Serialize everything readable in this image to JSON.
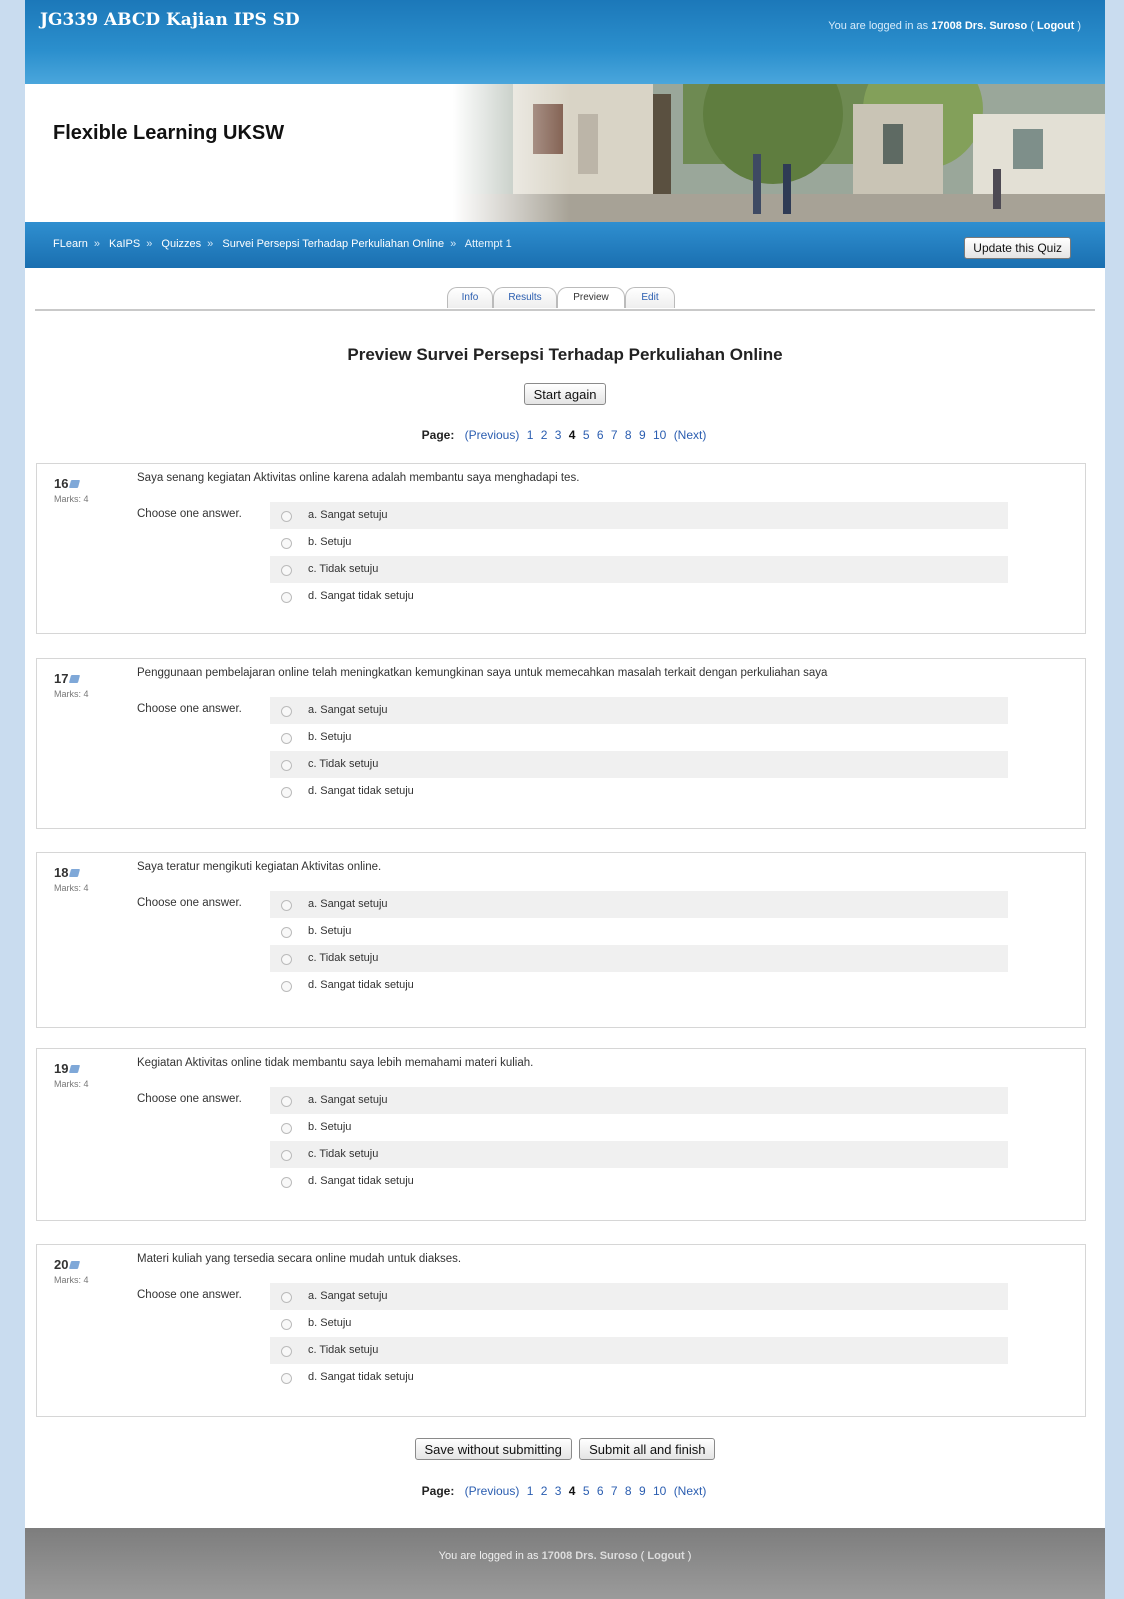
{
  "header": {
    "course_title": "JG339 ABCD Kajian IPS SD",
    "login_prefix": "You are logged in as",
    "user": "17008 Drs. Suroso",
    "logout": "Logout"
  },
  "banner": {
    "site_name": "Flexible Learning UKSW"
  },
  "breadcrumb": [
    "FLearn",
    "KaIPS",
    "Quizzes",
    "Survei Persepsi Terhadap Perkuliahan Online",
    "Attempt 1"
  ],
  "update_button": "Update this Quiz",
  "tabs": [
    "Info",
    "Results",
    "Preview",
    "Edit"
  ],
  "quiz_title": "Preview Survei Persepsi Terhadap Perkuliahan Online",
  "start_again": "Start again",
  "paging": {
    "label": "Page:",
    "previous": "(Previous)",
    "pages": [
      "1",
      "2",
      "3",
      "4",
      "5",
      "6",
      "7",
      "8",
      "9",
      "10"
    ],
    "current": "4",
    "next": "(Next)"
  },
  "choose_label": "Choose one answer.",
  "questions": [
    {
      "number": "16",
      "marks": "Marks: 4",
      "text": "Saya senang kegiatan Aktivitas online karena adalah membantu saya menghadapi tes.",
      "answers": [
        "a. Sangat setuju",
        "b. Setuju",
        "c. Tidak setuju",
        "d. Sangat tidak setuju"
      ]
    },
    {
      "number": "17",
      "marks": "Marks: 4",
      "text": "Penggunaan pembelajaran online telah meningkatkan kemungkinan saya untuk memecahkan masalah terkait dengan perkuliahan saya",
      "answers": [
        "a. Sangat setuju",
        "b. Setuju",
        "c. Tidak setuju",
        "d. Sangat tidak setuju"
      ]
    },
    {
      "number": "18",
      "marks": "Marks: 4",
      "text": "Saya teratur mengikuti kegiatan Aktivitas online.",
      "answers": [
        "a. Sangat setuju",
        "b. Setuju",
        "c. Tidak setuju",
        "d. Sangat tidak setuju"
      ]
    },
    {
      "number": "19",
      "marks": "Marks: 4",
      "text": "Kegiatan Aktivitas online tidak membantu saya lebih memahami materi kuliah.",
      "answers": [
        "a. Sangat setuju",
        "b. Setuju",
        "c. Tidak setuju",
        "d. Sangat tidak setuju"
      ]
    },
    {
      "number": "20",
      "marks": "Marks: 4",
      "text": "Materi kuliah yang tersedia secara online mudah untuk diakses.",
      "answers": [
        "a. Sangat setuju",
        "b. Setuju",
        "c. Tidak setuju",
        "d. Sangat tidak setuju"
      ]
    }
  ],
  "bottom_buttons": {
    "save": "Save without submitting",
    "submit": "Submit all and finish"
  },
  "colors": {
    "header_blue": "#1c78b9",
    "link_blue": "#2a5db0",
    "footer_gray": "#8c8c8c"
  }
}
